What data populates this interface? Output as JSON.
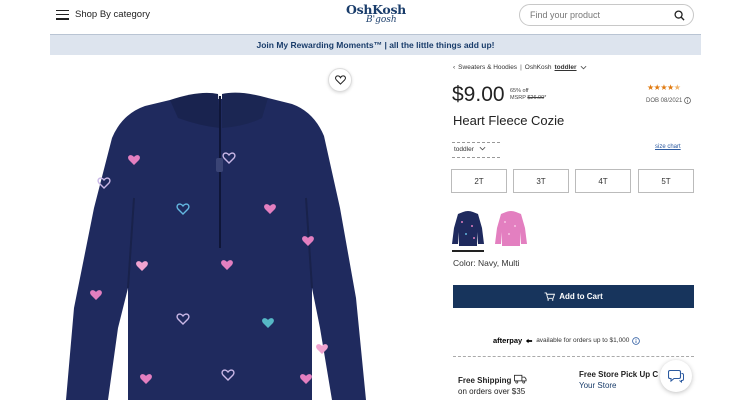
{
  "header": {
    "menu_label": "Shop By category",
    "logo_line1": "OshKosh",
    "logo_line2": "B'gosh",
    "search_placeholder": "Find your product"
  },
  "promo_banner": "Join My Rewarding Moments™ | all the little things add up!",
  "breadcrumb": {
    "items": [
      "Sweaters & Hoodies",
      "OshKosh",
      "toddler"
    ]
  },
  "product": {
    "price": "$9.00",
    "discount": "65% off",
    "msrp_label": "MSRP",
    "msrp_value": "$26.00",
    "msrp_note": "*",
    "rating": 4.5,
    "rating_max": 5,
    "dob": "DOB 08/2021",
    "title": "Heart Fleece Cozie",
    "size_group": "toddler",
    "size_chart": "size chart",
    "sizes": [
      "2T",
      "3T",
      "4T",
      "5T"
    ],
    "color_label": "Color: Navy, Multi",
    "add_to_cart": "Add to Cart"
  },
  "afterpay": {
    "logo": "afterpay",
    "text": "available for orders up to $1,000"
  },
  "shipping": {
    "title": "Free Shipping",
    "subtitle": "on orders over $35"
  },
  "pickup": {
    "title": "Free Store Pick Up C",
    "link": "Your Store"
  },
  "colors": {
    "navy": "#1f2a5e",
    "pink": "#e37fc0",
    "brand": "#17345c",
    "star": "#e07a10",
    "promo_bg": "#dde4ee"
  }
}
